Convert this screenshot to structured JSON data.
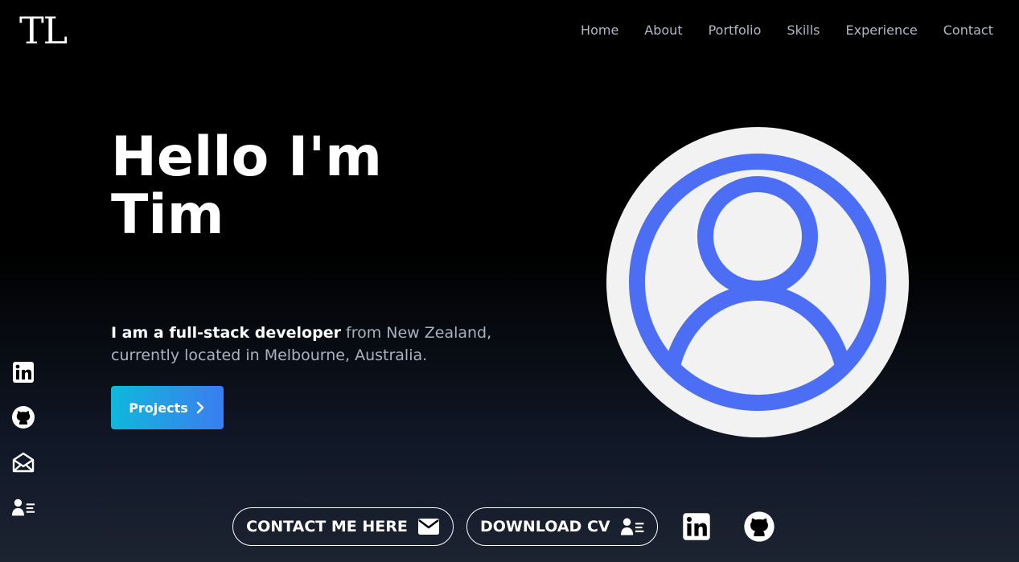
{
  "header": {
    "logo": "TL",
    "nav": [
      "Home",
      "About",
      "Portfolio",
      "Skills",
      "Experience",
      "Contact"
    ]
  },
  "hero": {
    "title_line1": "Hello I'm",
    "title_line2": "Tim",
    "tagline_bold": "I am a full-stack developer",
    "tagline_rest": " from New Zealand, currently located in Melbourne, Australia.",
    "projects_label": "Projects"
  },
  "side_social": {
    "icons": [
      "linkedin-icon",
      "github-icon",
      "mail-icon",
      "contact-card-icon"
    ]
  },
  "bottom": {
    "contact_label": "CONTACT ME HERE",
    "cv_label": "DOWNLOAD CV"
  },
  "colors": {
    "accent_blue": "#4c6ef5",
    "button_gradient_start": "#0fb8dc",
    "button_gradient_end": "#3b7df0",
    "nav_text": "#b2b8c3"
  }
}
